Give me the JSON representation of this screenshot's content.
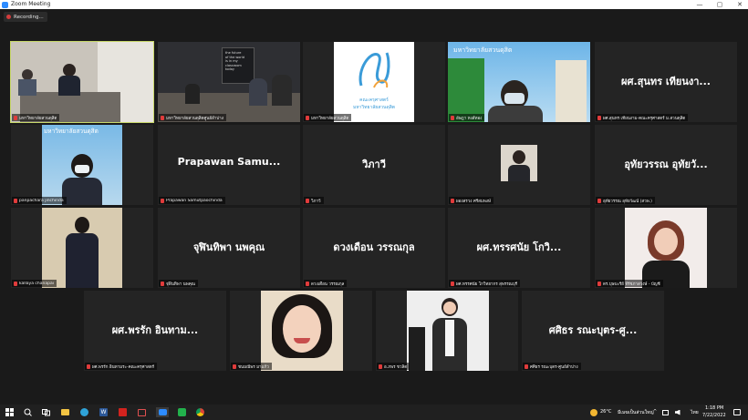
{
  "window": {
    "title": "Zoom Meeting",
    "controls": [
      "—",
      "▢",
      "✕"
    ]
  },
  "recording": {
    "label": "Recording..."
  },
  "tiles": [
    {
      "name": "มหาวิทยาลัยสวนดุสิต"
    },
    {
      "name": "มหาวิทยาลัยสวนดุสิตศูนย์ลำปาง"
    },
    {
      "name": "มหาวิทยาลัยสวนดุสิต"
    },
    {
      "name": "อัษฎา หงส์ทอง"
    },
    {
      "big": "ผศ.สุนทร เทียนงา...",
      "name": "ผศ.สุนทร เทียนงาม-คณะครุศาสตร์ ม.สวนดุสิต"
    },
    {
      "name": "panpachara jinchinda"
    },
    {
      "big": "Prapawan  Samu...",
      "name": "Prapawan Samutpaochinda"
    },
    {
      "big": "วิภาวี",
      "name": "วิภาวี"
    },
    {
      "name": "ผองสรวง ศรีสมพงษ์"
    },
    {
      "big": "อุทัยวรรณ อุทัยวั...",
      "name": "อุทัยวรรณ อุทัยวัฒน์ (สวพ.)"
    },
    {
      "name": "kallaya chanapai"
    },
    {
      "big": "จุฬินทิพา นพคุณ",
      "name": "จุฬินทิพา นพคุณ"
    },
    {
      "big": "ดวงเดือน วรรณกุล",
      "name": "ดวงเดือน วรรณกุล"
    },
    {
      "big": "ผศ.ทรรศนัย โกวิ...",
      "name": "ผศ.ทรรศนัย โกวิทยากร สุพรรณบุรี"
    },
    {
      "name": "ดร.บุษบะรีย์ จีรัชภาสวงษ์ - บัญชี"
    },
    {
      "big": "ผศ.พรรัก  อินทาม...",
      "name": "ผศ.พรรัก อินทามระ-คณะครุศาสตร์"
    },
    {
      "name": "ชนมณีพร มาแก้ว"
    },
    {
      "name": "อ.ภพร ชวลิต"
    },
    {
      "big": "ศศิธร รณะบุตร-ศู...",
      "name": "ศศิธร รณะบุตร-ศูนย์ลำปาง"
    }
  ],
  "slides": {
    "logo_line1": "คณะครุศาสตร์",
    "logo_line2": "มหาวิทยาลัยสวนดุสิต",
    "banner": "มหาวิทยาลัยสวนดุสิต",
    "poster_line1": "the future",
    "poster_line2": "of the world",
    "poster_line3": "is in my",
    "poster_line4": "classroom",
    "poster_line5": "today"
  },
  "taskbar": {
    "weather": "26°C",
    "weather_desc": "มีเมฆเป็นส่วนใหญ่",
    "lang": "ไทย",
    "time": "1:18 PM",
    "date": "7/22/2022"
  }
}
